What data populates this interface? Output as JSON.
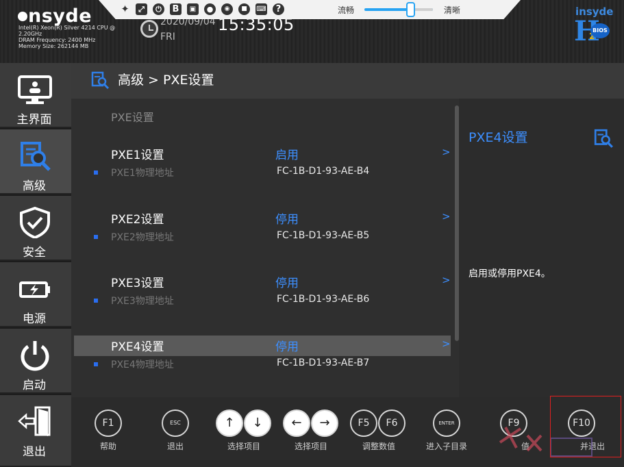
{
  "header": {
    "logo": "nsyde",
    "cpu": "Intel(R) Xeon(R) Silver 4214 CPU @",
    "cpu_speed": "2.20GHz",
    "dram": "DRAM Frequency: 2400 MHz",
    "memory": "Memory Size: 262144 MB",
    "date": "2020/09/04",
    "weekday": "FRI",
    "time": "15:35:05",
    "slider_left_label": "流畅",
    "slider_right_label": "清晰",
    "slider_level": 0.5,
    "brand_top": "insyde",
    "brand_h": "H",
    "brand_two": "2",
    "brand_bios": "BIOS",
    "toolbar_icons": [
      "pin-icon",
      "fullscreen-icon",
      "power-icon",
      "b-icon",
      "image-icon",
      "mouse-icon",
      "record-icon",
      "video-icon",
      "keyboard-icon",
      "help-icon"
    ],
    "toolbar_b": "B",
    "toolbar_help": "?"
  },
  "sidebar": {
    "items": [
      {
        "label": "主界面",
        "icon": "monitor-icon"
      },
      {
        "label": "高级",
        "icon": "advanced-search-icon"
      },
      {
        "label": "安全",
        "icon": "shield-icon"
      },
      {
        "label": "电源",
        "icon": "battery-icon"
      },
      {
        "label": "启动",
        "icon": "power-icon"
      },
      {
        "label": "退出",
        "icon": "exit-door-icon"
      }
    ]
  },
  "main": {
    "breadcrumb": "高级 > PXE设置",
    "caption": "PXE设置",
    "rows": [
      {
        "title": "PXE1设置",
        "value": "启用",
        "arrow": ">",
        "sublabel": "PXE1物理地址",
        "mac": "FC-1B-D1-93-AE-B4"
      },
      {
        "title": "PXE2设置",
        "value": "停用",
        "arrow": ">",
        "sublabel": "PXE2物理地址",
        "mac": "FC-1B-D1-93-AE-B5"
      },
      {
        "title": "PXE3设置",
        "value": "停用",
        "arrow": ">",
        "sublabel": "PXE3物理地址",
        "mac": "FC-1B-D1-93-AE-B6"
      },
      {
        "title": "PXE4设置",
        "value": "停用",
        "arrow": ">",
        "sublabel": "PXE4物理地址",
        "mac": "FC-1B-D1-93-AE-B7"
      }
    ]
  },
  "help": {
    "title": "PXE4设置",
    "text": "启用或停用PXE4。"
  },
  "footer": {
    "keys": {
      "f1": "F1",
      "esc": "ESC",
      "up": "↑",
      "down": "↓",
      "left": "←",
      "right": "→",
      "f5": "F5",
      "f6": "F6",
      "enter": "ENTER",
      "f9": "F9",
      "f10": "F10"
    },
    "labels": {
      "help": "帮助",
      "exit": "退出",
      "select_item_1": "选择项目",
      "select_item_2": "选择项目",
      "adjust": "调整数值",
      "enter_sub": "进入子目录",
      "f9_tail": "值",
      "f10_tail": "并退出"
    }
  },
  "colors": {
    "accent_blue": "#3d8fff",
    "selection_bg": "#5a5a5a",
    "slider_blue": "#27a3f2",
    "annotation_red": "#e02020"
  }
}
